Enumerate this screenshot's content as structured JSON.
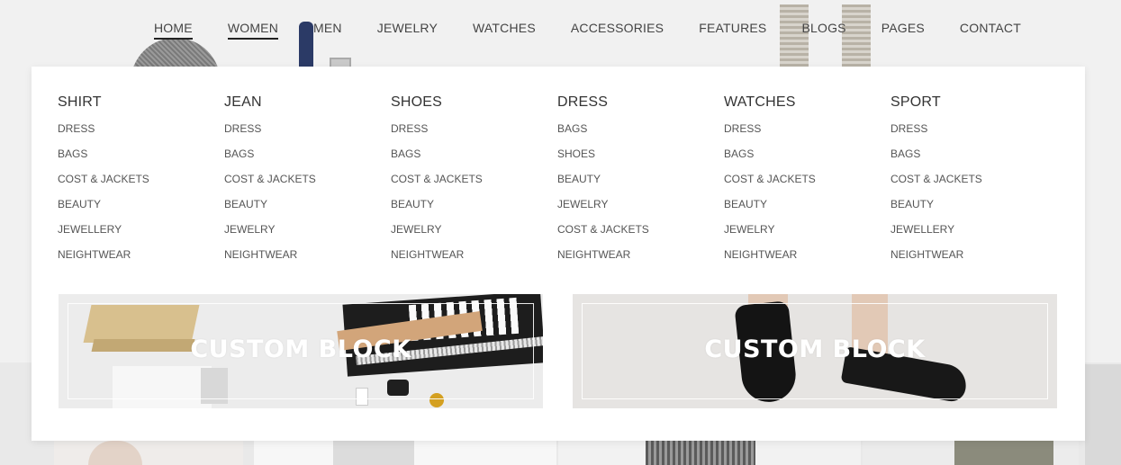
{
  "nav": {
    "items": [
      {
        "label": "HOME",
        "active": true
      },
      {
        "label": "WOMEN",
        "active": true
      },
      {
        "label": "MEN",
        "active": false
      },
      {
        "label": "JEWELRY",
        "active": false
      },
      {
        "label": "WATCHES",
        "active": false
      },
      {
        "label": "ACCESSORIES",
        "active": false
      },
      {
        "label": "FEATURES",
        "active": false
      },
      {
        "label": "BLOGS",
        "active": false
      },
      {
        "label": "PAGES",
        "active": false
      },
      {
        "label": "CONTACT",
        "active": false
      }
    ]
  },
  "mega_menu": {
    "columns": [
      {
        "title": "SHIRT",
        "links": [
          "DRESS",
          "BAGS",
          "COST & JACKETS",
          "BEAUTY",
          "JEWELLERY",
          "NEIGHTWEAR"
        ]
      },
      {
        "title": "JEAN",
        "links": [
          "DRESS",
          "BAGS",
          "COST & JACKETS",
          "BEAUTY",
          "JEWELRY",
          "NEIGHTWEAR"
        ]
      },
      {
        "title": "SHOES",
        "links": [
          "DRESS",
          "BAGS",
          "COST & JACKETS",
          "BEAUTY",
          "JEWELRY",
          "NEIGHTWEAR"
        ]
      },
      {
        "title": "DRESS",
        "links": [
          "BAGS",
          "SHOES",
          "BEAUTY",
          "JEWELRY",
          "COST & JACKETS",
          "NEIGHTWEAR"
        ]
      },
      {
        "title": "WATCHES",
        "links": [
          "DRESS",
          "BAGS",
          "COST & JACKETS",
          "BEAUTY",
          "JEWELRY",
          "NEIGHTWEAR"
        ]
      },
      {
        "title": "SPORT",
        "links": [
          "DRESS",
          "BAGS",
          "COST & JACKETS",
          "BEAUTY",
          "JEWELLERY",
          "NEIGHTWEAR"
        ]
      }
    ],
    "blocks": [
      {
        "title": "CUSTOM BLOCK"
      },
      {
        "title": "CUSTOM BLOCK"
      }
    ]
  },
  "colors": {
    "page_background": "#f1f1f1",
    "menu_background": "#ffffff",
    "text": "#333333"
  }
}
